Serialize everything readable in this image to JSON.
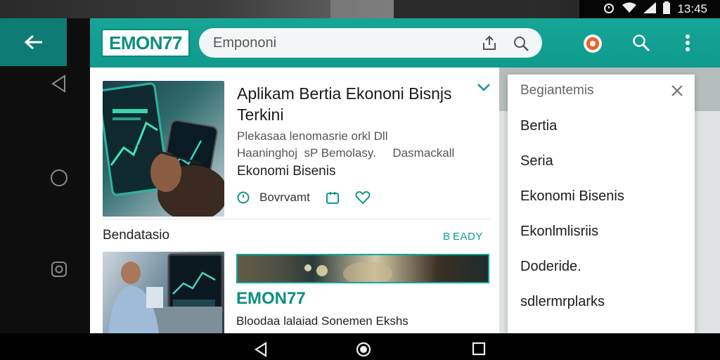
{
  "status_bar": {
    "time": "13:45"
  },
  "app_bar": {
    "logo": "EMON77",
    "search_placeholder": "Empononi"
  },
  "featured_article": {
    "title": "Aplikam Bertia Ekononi Bisnjs Terkini",
    "description_lines": [
      "Plekasaa lenomasrie orkl Dll",
      "Haaninghoj  sP Bemolasy.     Dasmackall"
    ],
    "category": "Ekonomi Bisenis",
    "action_label": "Bovrvamt"
  },
  "section": {
    "title": "Bendatasio",
    "action": "B EADY"
  },
  "second_article": {
    "brand": "EMON77",
    "snippet": "Bloodaa lalaiad Sonemen Ekshs"
  },
  "menu": {
    "header": "Begiantemis",
    "items": [
      "Bertia",
      "Seria",
      "Ekonomi Bisenis",
      "Ekonlmlisriis",
      "Doderide.",
      "sdlermrplarks"
    ]
  },
  "colors": {
    "teal": "#0f9a8c",
    "accent_orange": "#e8622c"
  }
}
